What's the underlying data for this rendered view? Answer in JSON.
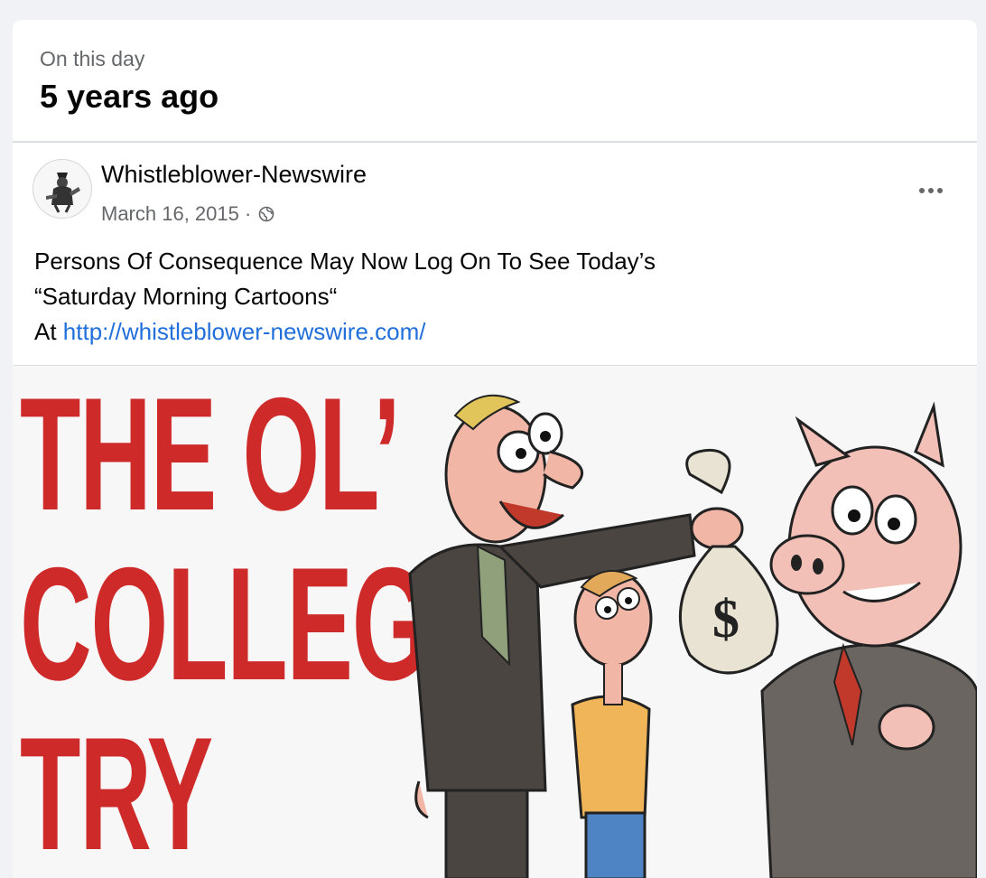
{
  "memory": {
    "kicker": "On this day",
    "headline": "5 years ago"
  },
  "post": {
    "author": "Whistleblower-Newswire",
    "date": "March 16, 2015 ·",
    "more_icon": "ellipsis-icon",
    "privacy_icon": "globe-icon",
    "text_line1": "Persons Of Consequence May Now Log On To See Today’s",
    "text_line2": "“Saturday Morning Cartoons“",
    "text_line3_prefix": "At ",
    "link": "http://whistleblower-newswire.com/"
  },
  "image": {
    "title_line1": "THE OL’",
    "title_line2": "COLLEGE",
    "title_line3": "TRY",
    "bag_symbol": "$"
  },
  "colors": {
    "accent_link": "#216fdb",
    "title_red": "#cf2a2a"
  }
}
